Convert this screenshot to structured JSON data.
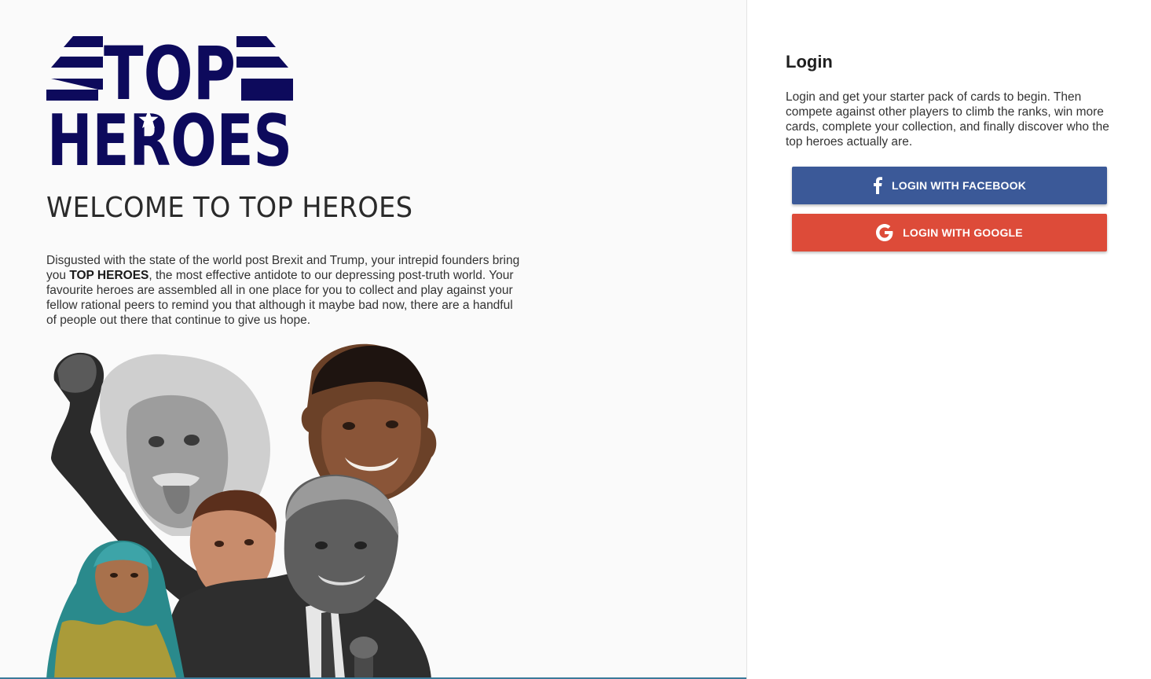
{
  "colors": {
    "logo_navy": "#0d0a5c",
    "facebook_blue": "#3b5998",
    "google_red": "#dd4b39",
    "left_bg": "#fafafa"
  },
  "logo": {
    "line1": "TOP",
    "line2": "HEROES",
    "icon": "star-icon"
  },
  "welcome": {
    "title": "WELCOME TO TOP HEROES",
    "intro_before": "Disgusted with the state of the world post Brexit and Trump, your intrepid founders bring you ",
    "intro_bold": "TOP HEROES",
    "intro_after": ", the most effective antidote to our depressing post-truth world. Your favourite heroes are assembled all in one place for you to collect and play against your fellow rational peers to remind you that although it maybe bad now, there are a handful of people out there that continue to give us hope."
  },
  "login": {
    "heading": "Login",
    "description": "Login and get your starter pack of cards to begin. Then compete against other players to climb the ranks, win more cards, complete your collection, and finally discover who the top heroes actually are.",
    "facebook_label": "LOGIN WITH FACEBOOK",
    "facebook_icon": "facebook-icon",
    "google_label": "LOGIN WITH GOOGLE",
    "google_icon": "google-icon"
  }
}
